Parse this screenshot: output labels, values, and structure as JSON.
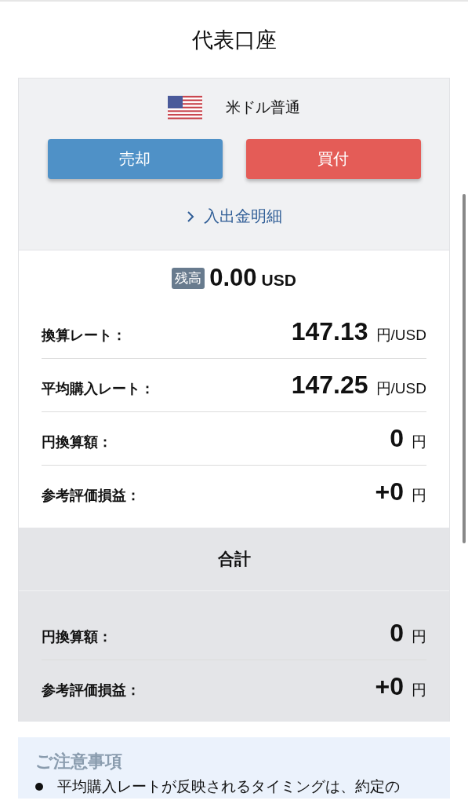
{
  "title": "代表口座",
  "account": {
    "name": "米ドル普通"
  },
  "buttons": [
    {
      "label": "売却",
      "kind": "sell"
    },
    {
      "label": "買付",
      "kind": "buy"
    }
  ],
  "link": {
    "label": "入出金明細"
  },
  "balance": {
    "badge": "残高",
    "amount": "0.00",
    "currency": "USD"
  },
  "rows": [
    {
      "label": "換算レート：",
      "value": "147.13",
      "unit": "円/USD"
    },
    {
      "label": "平均購入レート：",
      "value": "147.25",
      "unit": "円/USD"
    },
    {
      "label": "円換算額：",
      "value": "0",
      "unit": "円"
    },
    {
      "label": "参考評価損益：",
      "value": "+0",
      "unit": "円"
    }
  ],
  "total": {
    "title": "合計",
    "rows": [
      {
        "label": "円換算額：",
        "value": "0",
        "unit": "円"
      },
      {
        "label": "参考評価損益：",
        "value": "+0",
        "unit": "円"
      }
    ]
  },
  "notice": {
    "title": "ご注意事項",
    "items": [
      "平均購入レートが反映されるタイミングは、約定の"
    ]
  }
}
